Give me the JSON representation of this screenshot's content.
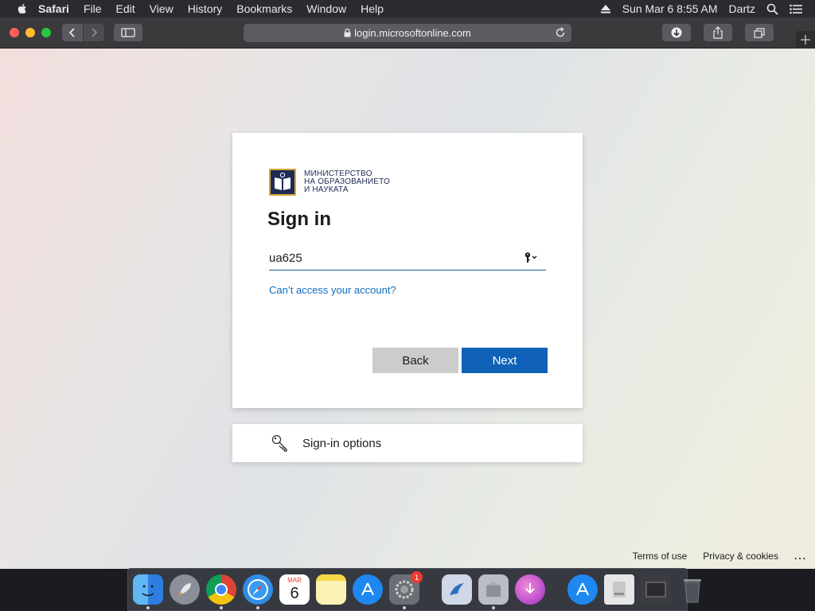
{
  "menubar": {
    "app_name": "Safari",
    "items": [
      "File",
      "Edit",
      "View",
      "History",
      "Bookmarks",
      "Window",
      "Help"
    ],
    "date_time": "Sun Mar 6  8:55 AM",
    "user": "Dartz"
  },
  "toolbar": {
    "address": "login.microsoftonline.com"
  },
  "signin": {
    "logo_lines": [
      "МИНИСТЕРСТВО",
      "НА ОБРАЗОВАНИЕТО",
      "И НАУКАТА"
    ],
    "title": "Sign in",
    "username_value": "ua625",
    "cant_access_link": "Can’t access your account?",
    "back_button": "Back",
    "next_button": "Next"
  },
  "options": {
    "label": "Sign-in options"
  },
  "footer": {
    "terms": "Terms of use",
    "privacy": "Privacy & cookies",
    "more": "..."
  },
  "dock": {
    "calendar_month": "MAR",
    "calendar_day": "6",
    "settings_badge": "1"
  },
  "colors": {
    "accent": "#0f62b8",
    "link": "#0f6cbd",
    "back_button": "#cccccc"
  }
}
